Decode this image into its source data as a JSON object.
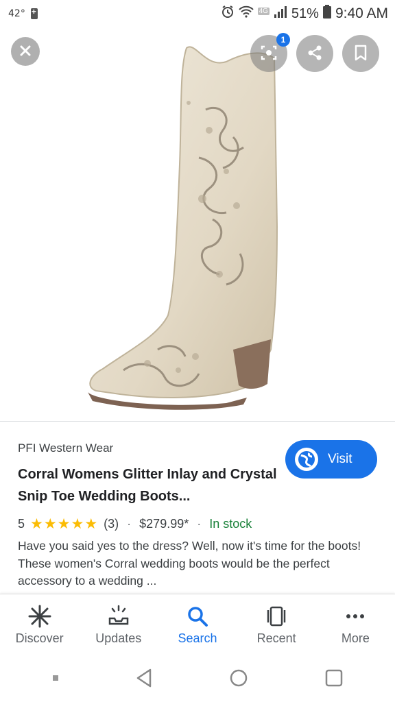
{
  "status_bar": {
    "temperature": "42°",
    "network": "4G",
    "battery": "51%",
    "time": "9:40 AM"
  },
  "image_viewer": {
    "lens_badge_count": "1",
    "icons": {
      "close": "close-icon",
      "lens": "lens-icon",
      "share": "share-icon",
      "save": "bookmark-icon"
    }
  },
  "product": {
    "merchant": "PFI Western Wear",
    "title": "Corral Womens Glitter Inlay and Crystal Snip Toe Wedding Boots...",
    "rating_value": "5",
    "stars": "★★★★★",
    "review_count": "(3)",
    "price": "$279.99*",
    "availability": "In stock",
    "description": "Have you said yes to the dress? Well, now it's time for the boots! These women's Corral wedding boots would be the perfect accessory to a wedding ...",
    "visit_label": "Visit"
  },
  "bottom_nav": {
    "items": [
      {
        "label": "Discover",
        "icon": "asterisk-icon",
        "active": false
      },
      {
        "label": "Updates",
        "icon": "updates-icon",
        "active": false
      },
      {
        "label": "Search",
        "icon": "search-icon",
        "active": true
      },
      {
        "label": "Recent",
        "icon": "recent-icon",
        "active": false
      },
      {
        "label": "More",
        "icon": "more-icon",
        "active": false
      }
    ]
  },
  "colors": {
    "accent": "#1a73e8",
    "stars": "#fbbc04",
    "in_stock": "#188038"
  }
}
